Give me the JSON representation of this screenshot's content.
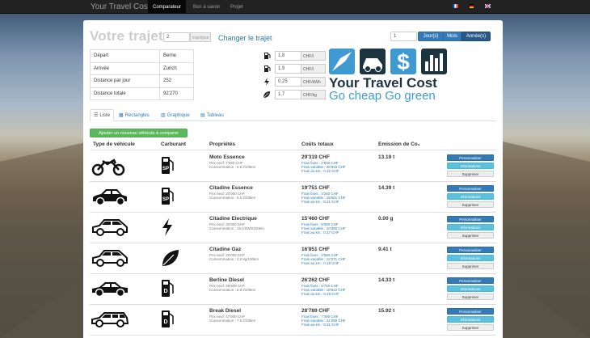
{
  "navbar": {
    "brand": "Your Travel Cost",
    "items": [
      {
        "label": "Comparateur",
        "active": true
      },
      {
        "label": "Bon à savoir",
        "active": false
      },
      {
        "label": "Projet",
        "active": false
      }
    ],
    "flags": [
      "fr",
      "de",
      "en"
    ]
  },
  "trip": {
    "title": "Votre trajet",
    "persons_value": "2",
    "persons_unit": "trajet/jour",
    "change_label": "Changer le trajet",
    "period_value": "1",
    "period_options": [
      "Jour(s)",
      "Mois",
      "Année(s)"
    ],
    "period_selected": "Année(s)",
    "rows": [
      {
        "label": "Départ",
        "value": "Berne"
      },
      {
        "label": "Arrivée",
        "value": "Zurich"
      },
      {
        "label": "Distance par jour",
        "value": "252"
      },
      {
        "label": "Distance totale",
        "value": "92'270"
      }
    ]
  },
  "prices": [
    {
      "icon": "gas-pump-icon",
      "value": "1.8",
      "unit": "CHF/l"
    },
    {
      "icon": "gas-pump-icon",
      "value": "1.9",
      "unit": "CHF/l"
    },
    {
      "icon": "lightning-icon",
      "value": "0.25",
      "unit": "CHF/kWh"
    },
    {
      "icon": "leaf-icon",
      "value": "1.7",
      "unit": "CHF/kg"
    }
  ],
  "logo": {
    "title": "Your Travel Cost",
    "tagline": "Go cheap Go green"
  },
  "tabs": [
    {
      "label": "Liste",
      "active": true
    },
    {
      "label": "Rectangles",
      "active": false
    },
    {
      "label": "Graphique",
      "active": false
    },
    {
      "label": "Tableau",
      "active": false
    }
  ],
  "add_vehicle_label": "Ajouter un nouveau véhicule à comparer",
  "columns": {
    "type": "Type de véhicule",
    "fuel": "Carburant",
    "props": "Propriétés",
    "costs": "Coûts totaux",
    "emission": "Emission de Co₂"
  },
  "vehicles": [
    {
      "type": "moto",
      "fuel": "sp",
      "name": "Moto Essence",
      "price": "Prix neuf: 7'500 CHF",
      "consumption": "Consommation : 5.5 l/100km",
      "total": "29'319 CHF",
      "fixed": "Frais fixes : 2'500 CHF",
      "variable": "Frais variable : 26'819 CHF",
      "perkm": "Frais au km : 0.32 CHF",
      "emission": "13.19 t"
    },
    {
      "type": "citadine",
      "fuel": "sp",
      "name": "Citadine Essence",
      "price": "Prix neuf: 20'000 CHF",
      "consumption": "Consommation : 6.0 l/100km",
      "total": "19'751 CHF",
      "fixed": "Frais fixes : 4'250 CHF",
      "variable": "Frais variable : 15'501 CHF",
      "perkm": "Frais au km : 0.21 CHF",
      "emission": "14.39 t"
    },
    {
      "type": "hatch",
      "fuel": "elec",
      "name": "Citadine Electrique",
      "price": "Prix neuf: 30'000 CHF",
      "consumption": "Consommation : 15.0 kWh/100km",
      "total": "15'460 CHF",
      "fixed": "Frais fixes : 5'080 CHF",
      "variable": "Frais variable : 10'380 CHF",
      "perkm": "Frais au km : 0.17 CHF",
      "emission": "0.00 g"
    },
    {
      "type": "hatch",
      "fuel": "gaz",
      "name": "Citadine Gaz",
      "price": "Prix neuf: 25'000 CHF",
      "consumption": "Consommation : 4.0 kg/100km",
      "total": "16'851 CHF",
      "fixed": "Frais fixes : 4'580 CHF",
      "variable": "Frais variable : 12'271 CHF",
      "perkm": "Frais au km : 0.18 CHF",
      "emission": "9.41 t"
    },
    {
      "type": "sedan",
      "fuel": "d",
      "name": "Berline Diesel",
      "price": "Prix neuf: 38'000 CHF",
      "consumption": "Consommation : 6.6 l/100km",
      "total": "26'262 CHF",
      "fixed": "Frais fixes : 6'740 CHF",
      "variable": "Frais variable : 19'522 CHF",
      "perkm": "Frais au km : 0.28 CHF",
      "emission": "14.33 t"
    },
    {
      "type": "break",
      "fuel": "d",
      "name": "Break Diesel",
      "price": "Prix neuf: 47'000 CHF",
      "consumption": "Consommation : 7.5 l/100km",
      "total": "28'789 CHF",
      "fixed": "Frais fixes : 7'490 CHF",
      "variable": "Frais variable : 21'299 CHF",
      "perkm": "Frais au km : 0.31 CHF",
      "emission": "15.92 t"
    }
  ],
  "row_buttons": {
    "customize": "Personnaliser",
    "info": "Informations",
    "delete": "Supprimer"
  },
  "colors": {
    "navbar": "#222222",
    "primary": "#337ab7",
    "info": "#5bc0de",
    "success": "#5cb85c",
    "logo_blue": "#3f9ad3",
    "logo_dark": "#1b3440",
    "tagline": "#3f9ad3"
  }
}
